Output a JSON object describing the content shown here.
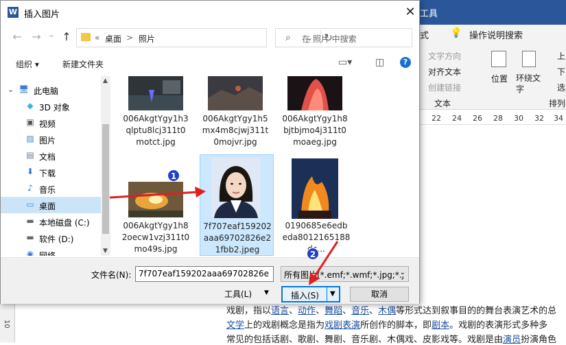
{
  "word": {
    "ribbon_tab_tools": "工具",
    "ribbon_tab_format": "式",
    "tell_me": "操作说明搜索",
    "text_direction": "文字方向",
    "align_text": "对齐文本",
    "create_link": "创建链接",
    "group_text": "文本",
    "position": "位置",
    "wrap_text": "环绕文字",
    "arrange": "排列",
    "up": "上",
    "down": "下",
    "select": "选",
    "ruler": [
      "22",
      "24",
      "26",
      "28",
      "30",
      "32",
      "34"
    ],
    "doc_lines": [
      {
        "parts": [
          {
            "t": "戏剧，指以",
            "link": false
          },
          {
            "t": "语言",
            "link": true
          },
          {
            "t": "、",
            "link": false
          },
          {
            "t": "动作",
            "link": true
          },
          {
            "t": "、",
            "link": false
          },
          {
            "t": "舞蹈",
            "link": true
          },
          {
            "t": "、",
            "link": false
          },
          {
            "t": "音乐",
            "link": true
          },
          {
            "t": "、",
            "link": false
          },
          {
            "t": "木偶",
            "link": true
          },
          {
            "t": "等形式达到叙事目的的舞台表演艺术的总",
            "link": false
          }
        ]
      },
      {
        "parts": [
          {
            "t": "文学",
            "link": true
          },
          {
            "t": "上的戏剧概念是指为",
            "link": false
          },
          {
            "t": "戏剧表演",
            "link": true
          },
          {
            "t": "所创作的脚本，即",
            "link": false
          },
          {
            "t": "剧本",
            "link": true
          },
          {
            "t": "。戏剧的表演形式多种多",
            "link": false
          }
        ]
      },
      {
        "parts": [
          {
            "t": "常见的包括话剧、歌剧、舞剧、音乐剧、木偶戏、皮影戏等。戏剧是由",
            "link": false
          },
          {
            "t": "演员",
            "link": true
          },
          {
            "t": "扮演角色",
            "link": false
          }
        ]
      }
    ],
    "vruler_label": "10"
  },
  "dialog": {
    "title": "插入图片",
    "close": "✕",
    "nav": {
      "back": "←",
      "forward": "→",
      "recent": "⌄",
      "up": "↑"
    },
    "breadcrumb": {
      "sep0": "«",
      "item1": "桌面",
      "sep1": ">",
      "item2": "照片",
      "dropdown": "⌄"
    },
    "refresh": "↻",
    "search_placeholder": "在 照片 中搜索",
    "toolbar": {
      "organize": "组织 ▾",
      "new_folder": "新建文件夹",
      "help": "?"
    },
    "sidebar": [
      {
        "id": "pc",
        "label": "此电脑",
        "icon": "computer-icon"
      },
      {
        "id": "3d",
        "label": "3D 对象",
        "icon": "cube-icon"
      },
      {
        "id": "video",
        "label": "视频",
        "icon": "video-icon"
      },
      {
        "id": "pictures",
        "label": "图片",
        "icon": "picture-icon"
      },
      {
        "id": "docs",
        "label": "文档",
        "icon": "document-icon"
      },
      {
        "id": "downloads",
        "label": "下载",
        "icon": "download-icon"
      },
      {
        "id": "music",
        "label": "音乐",
        "icon": "music-icon"
      },
      {
        "id": "desktop",
        "label": "桌面",
        "icon": "desktop-icon"
      },
      {
        "id": "c",
        "label": "本地磁盘 (C:)",
        "icon": "drive-icon"
      },
      {
        "id": "d",
        "label": "软件 (D:)",
        "icon": "drive-icon"
      },
      {
        "id": "network",
        "label": "网络",
        "icon": "network-icon"
      }
    ],
    "files": [
      {
        "name": "006AkgtYgy1h3qlptu8lcj311t0motct.jpg",
        "lines": [
          "006AkgtYgy1h3",
          "qlptu8lcj311t0",
          "motct.jpg"
        ]
      },
      {
        "name": "006AkgtYgy1h5mx4m8cjwj311t0mojvr.jpg",
        "lines": [
          "006AkgtYgy1h5",
          "mx4m8cjwj311t",
          "0mojvr.jpg"
        ]
      },
      {
        "name": "006AkgtYgy1h8bjtbjmo4j311t0moaeg.jpg",
        "lines": [
          "006AkgtYgy1h8",
          "bjtbjmo4j311t0",
          "moaeg.jpg"
        ]
      },
      {
        "name": "006AkgtYgy1h82oecw1vzj311t0mo49s.jpg",
        "lines": [
          "006AkgtYgy1h8",
          "2oecw1vzj311t0",
          "mo49s.jpg"
        ]
      },
      {
        "name": "7f707eaf159202aaa69702826e21fbb2.jpeg",
        "lines": [
          "7f707eaf159202",
          "aaa69702826e2",
          "1fbb2.jpeg"
        ]
      },
      {
        "name": "0190685e6edbeda8012165188dc...",
        "lines": [
          "0190685e6edb",
          "eda8012165188",
          "dc..."
        ]
      }
    ],
    "filename_label": "文件名(N):",
    "filename_value": "7f707eaf159202aaa69702826e",
    "filter_value": "所有图片(*.emf;*.wmf;*.jpg;*.j",
    "tools": "工具(L)",
    "insert": "插入(S)",
    "cancel": "取消",
    "badge1": "1",
    "badge2": "2"
  },
  "colors": {
    "accent": "#0078d7",
    "annotation_arrow": "#e02020",
    "badge": "#1f3fc7",
    "word_blue": "#2b579a",
    "link": "#1a4fa0"
  }
}
